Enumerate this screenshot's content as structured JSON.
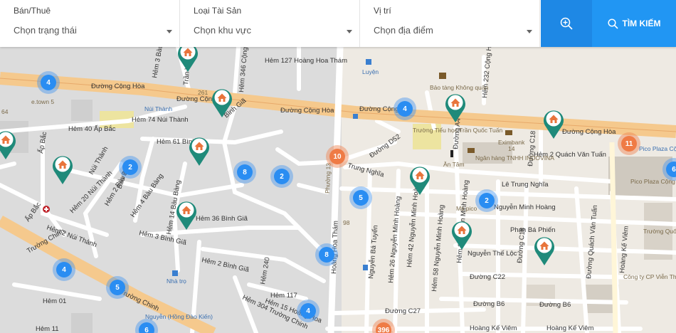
{
  "filters": [
    {
      "label": "Bán/Thuê",
      "value": "Chọn trạng thái"
    },
    {
      "label": "Loại Tài Sản",
      "value": "Chọn khu vực"
    },
    {
      "label": "Vị trí",
      "value": "Chọn địa điểm"
    }
  ],
  "search_label": "TÌM KIẾM",
  "clusters": [
    {
      "n": "4",
      "c": "blue"
    },
    {
      "n": "4",
      "c": "blue"
    },
    {
      "n": "2",
      "c": "blue"
    },
    {
      "n": "8",
      "c": "blue"
    },
    {
      "n": "2",
      "c": "blue"
    },
    {
      "n": "10",
      "c": "orange"
    },
    {
      "n": "5",
      "c": "blue"
    },
    {
      "n": "2",
      "c": "blue"
    },
    {
      "n": "11",
      "c": "orange"
    },
    {
      "n": "8",
      "c": "blue"
    },
    {
      "n": "4",
      "c": "blue"
    },
    {
      "n": "5",
      "c": "blue"
    },
    {
      "n": "4",
      "c": "blue"
    },
    {
      "n": "6",
      "c": "blue"
    },
    {
      "n": "396",
      "c": "orange"
    },
    {
      "n": "6",
      "c": "blue"
    }
  ],
  "road_labels": {
    "hem127": "Hẻm 127 Hoàng Hoa Thám",
    "conghoa1": "Đường Cộng Hòa",
    "conghoa2": "Đường Cộng Hòa",
    "conghoa3": "Đường Cộng Hòa",
    "conghoa4": "Đường Cộng",
    "conghoa5": "Đường Cộng Hòa",
    "hem40": "Hẻm 40 Ấp Bắc",
    "hem74": "Hẻm 74 Núi Thành",
    "hem61": "Hẻm 61 Bình",
    "binhgia": "Bình Giã",
    "hem2qvt": "Hẻm 2 Quách Văn Tuấn",
    "letrungnghia": "Lê Trung Nghĩa",
    "trungnghia": "Trung Nghĩa",
    "d52": "Đường D52",
    "hem20": "Hẻm 20 Núi Thành",
    "hem2bb": "Hẻm 2 Bàu Bàng",
    "hem4bb": "Hẻm 4 Bàu Bàng",
    "hem14bb": "Hẻm 14 Bàu Bàng",
    "hem36bg": "Hẻm 36 Bình Giã",
    "hem3bg": "Hẻm 3 Bình Giã",
    "hem2nt": "Hẻm 2 Núi Thành",
    "hem2bg": "Hẻm 2 Bình Giã",
    "nguyenminhhoang": "Nguyễn Minh Hoàng",
    "phanbaphien": "Phan Bá Phiến",
    "nguyentheloc": "Nguyễn Thế Lộc",
    "c22": "Đường C22",
    "b6a": "Đường B6",
    "b6b": "Đường B6",
    "c27": "Đường C27",
    "hoangkeviem1": "Hoàng Kế Viêm",
    "hoangkeviem2": "Hoàng Kế Viêm",
    "hoangkeviem3": "Hoàng Kế Viêm",
    "truongchinh1": "Trường Chinh",
    "truongchinh2": "Trường Chinh",
    "hem01": "Hẻm 01",
    "hem11": "Hẻm 11",
    "hem117": "Hẻm 117",
    "hem15": "Hẻm 15 Hoàng Hoa",
    "hem304": "Hẻm 304 Trường Chinh",
    "hem240": "Hẻm 240",
    "nbtuyen": "Nguyễn Bá Tuyển",
    "hem26": "Hẻm 26 Nguyễn Minh Hoàng",
    "hem42": "Hẻm 42 Nguyễn Minh Hoàng",
    "hem58": "Hẻm 58 Nguyễn Minh Hoàng",
    "quachvantuan": "Đường Quách Văn Tuấn",
    "c18a": "Đường C18",
    "c18b": "Đường C18",
    "hoanghoatham": "Hoàng Hoa Thám",
    "phuong13": "Phường 13",
    "apbac": "Ấp Bắc",
    "apbac2": "Ấp Bắc",
    "nuithanh": "Núi Thành",
    "baubang": "Bàu Bàng",
    "hem232": "Hẻm 232 Cộng Hòa",
    "hem346": "Hẻm 346 Cộng",
    "tranvan": "Trần Văn",
    "a4": "Đường A4",
    "hem2nmh": "Hẻm 2 Nguyễn Minh Hoàng",
    "hem3bb": "Hẻm 3 Bàu Bàng",
    "n98": "98",
    "n261": "261"
  },
  "poi_labels": {
    "luyen": "Luyện",
    "baotang": "Bảo tàng Không quân",
    "truongtieuhoc": "Trường Tiểu học Trần Quốc Tuấn",
    "eximbank": "Eximbank",
    "nganhang": "Ngân hàng TNHH INDOVINA",
    "antam": "Ăn Tâm",
    "mspico": "Ms pico",
    "picoplaza": "Pico Plaza Cộng Hòa",
    "pico": "Pico Plaza Cộng Hòa",
    "truongquocte": "Trường Quốc tế Á Châu",
    "congty": "Công ty CP Viễn Thông Tecapro Telecom",
    "nhatro": "Nhà trọ",
    "nuithanhpoi": "Núi Thành",
    "etown": "e.town 5",
    "n64": "64",
    "nguyen": "Nguyễn (Hồng Đào Kiến)",
    "n14": "14"
  }
}
